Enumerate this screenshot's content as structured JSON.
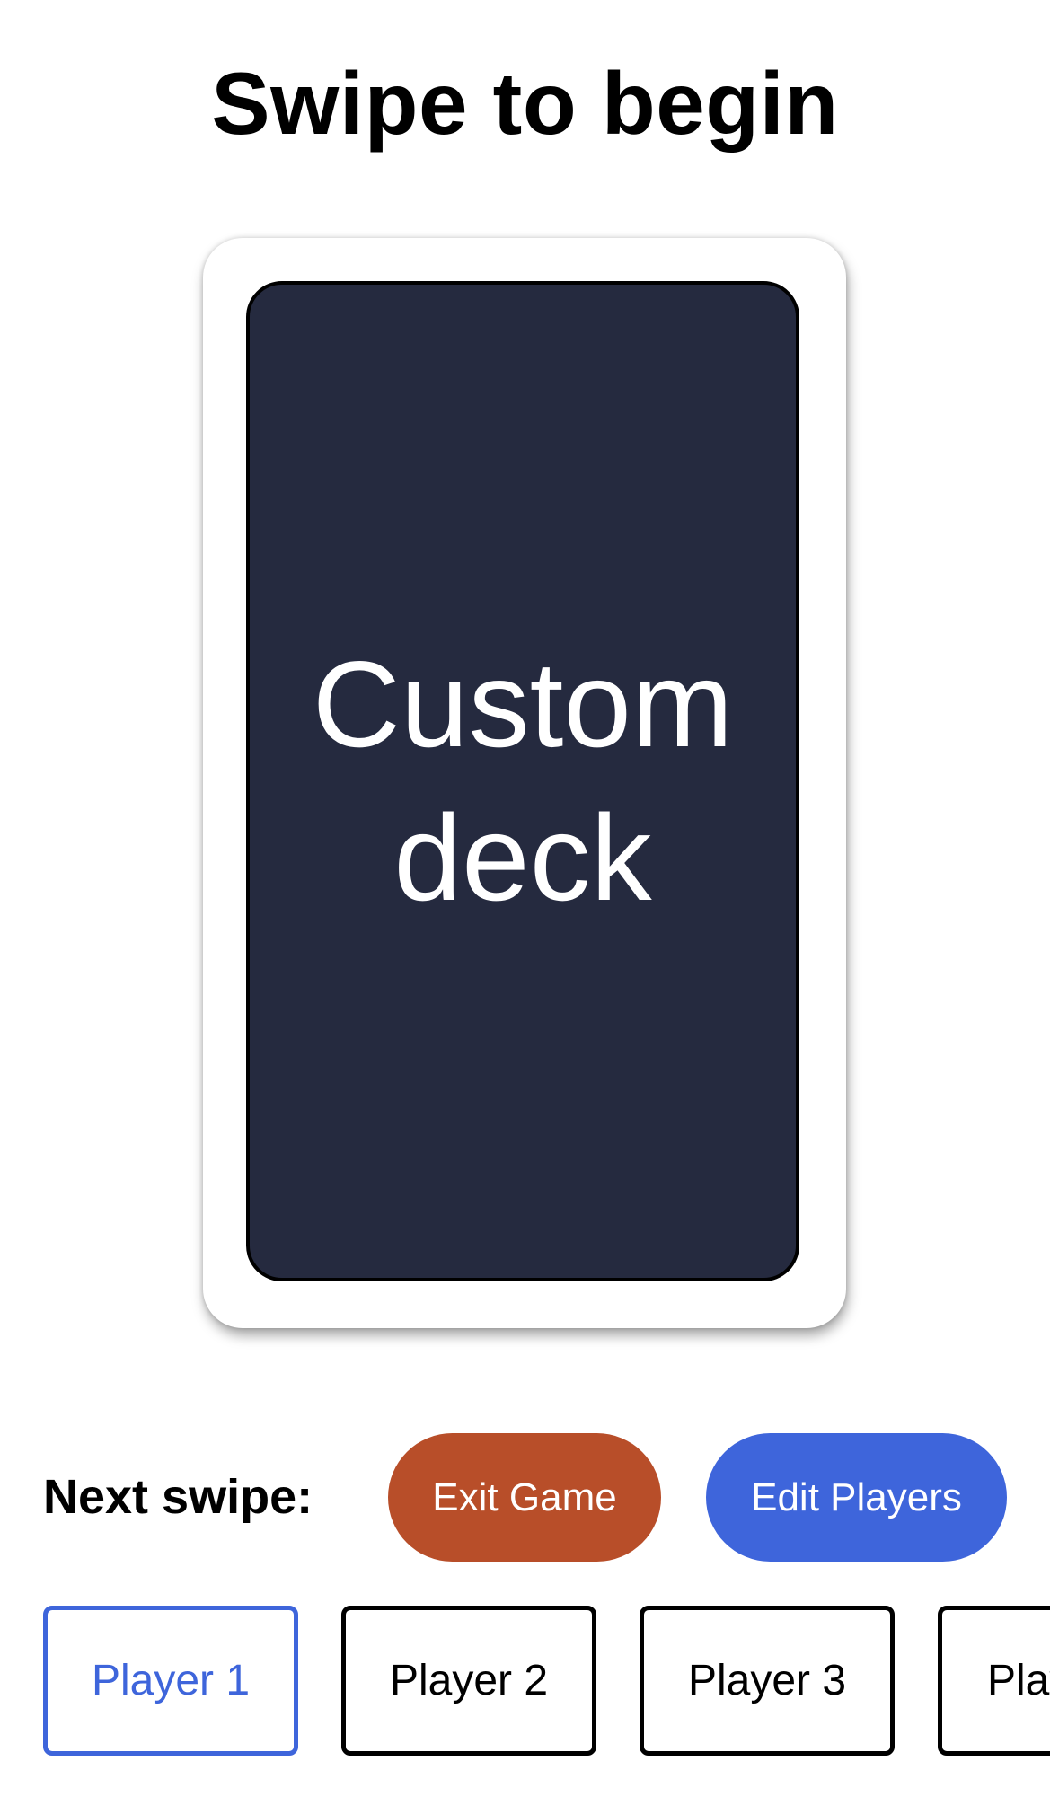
{
  "header": {
    "title": "Swipe to begin"
  },
  "card": {
    "text": "Custom deck",
    "face_color": "#252a3f"
  },
  "controls": {
    "next_swipe_label": "Next swipe:",
    "exit_label": "Exit Game",
    "edit_players_label": "Edit Players",
    "exit_color": "#b84e29",
    "edit_color": "#3e65db"
  },
  "players": [
    {
      "label": "Player 1",
      "active": true
    },
    {
      "label": "Player 2",
      "active": false
    },
    {
      "label": "Player 3",
      "active": false
    },
    {
      "label": "Play",
      "active": false
    }
  ]
}
